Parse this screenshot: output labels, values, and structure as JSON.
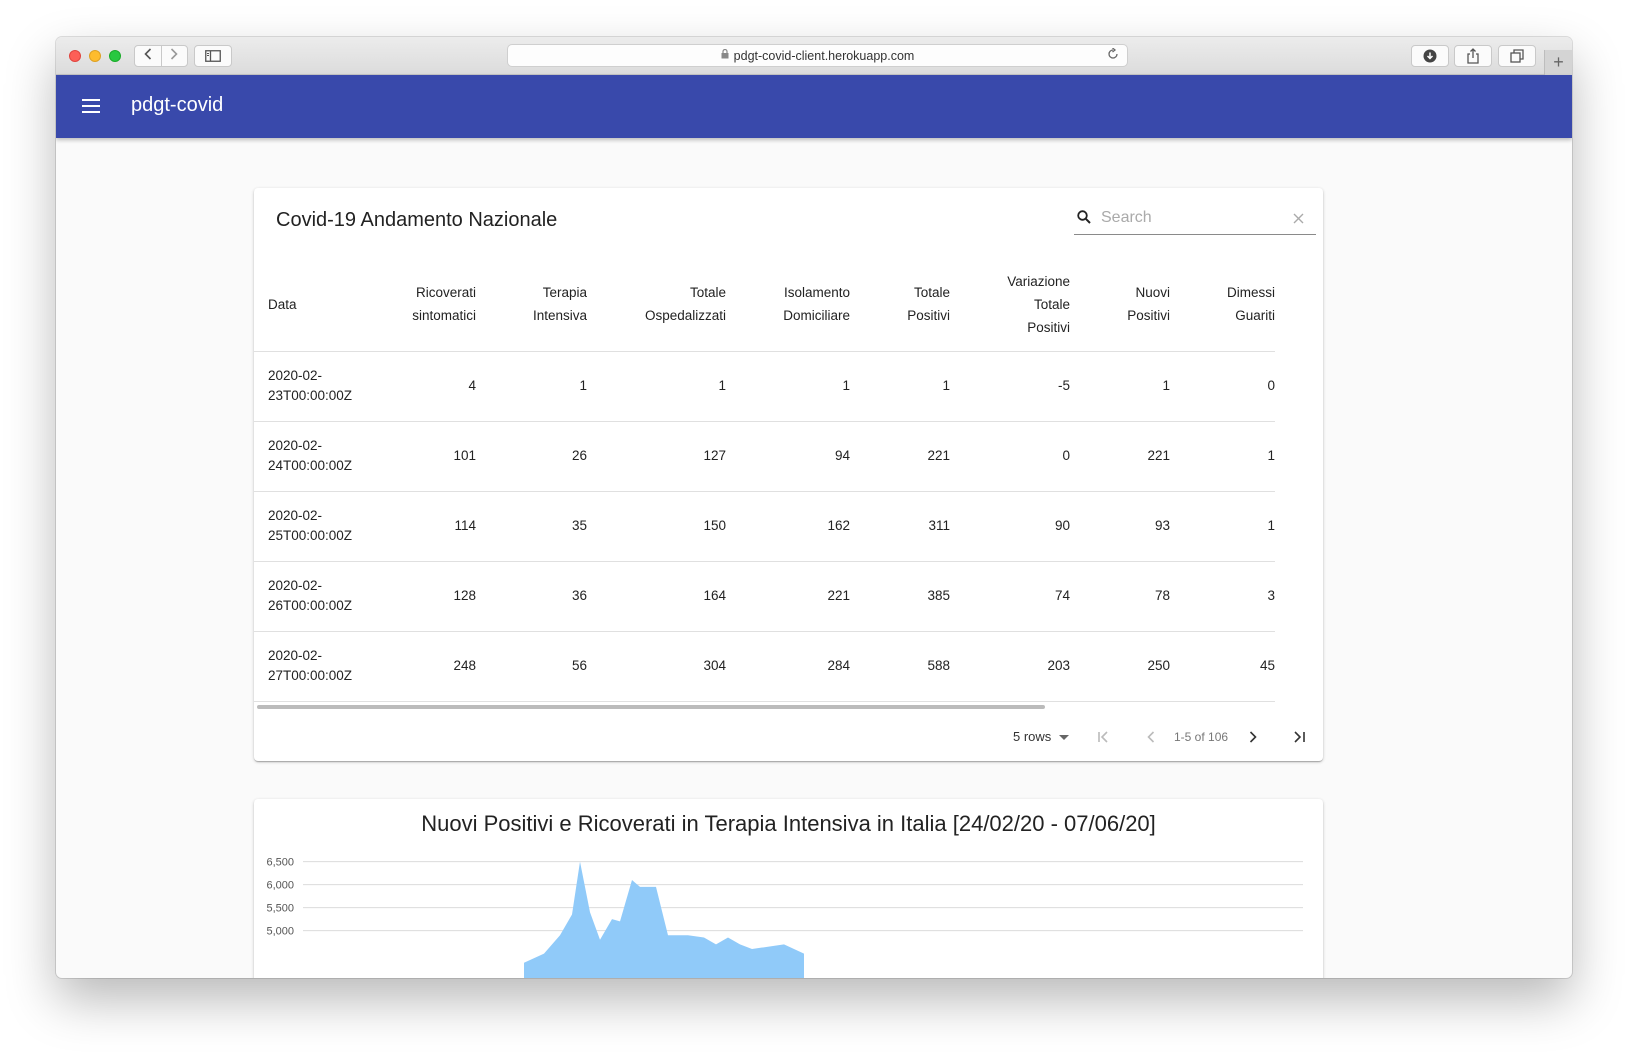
{
  "browser": {
    "url": "pdgt-covid-client.herokuapp.com",
    "back_icon": "chevron-left-icon",
    "forward_icon": "chevron-right-icon",
    "sidebar_icon": "sidebar-icon",
    "download_icon": "download-icon",
    "share_icon": "share-icon",
    "tabs_icon": "tabs-overview-icon",
    "new_tab_icon": "plus-icon"
  },
  "appbar": {
    "title": "pdgt-covid",
    "menu_icon": "menu-icon",
    "color": "#3949ab"
  },
  "table_card": {
    "title": "Covid-19 Andamento Nazionale",
    "search": {
      "placeholder": "Search",
      "value": ""
    },
    "columns": [
      [
        "Data"
      ],
      [
        "Ricoverati",
        "sintomatici"
      ],
      [
        "Terapia",
        "Intensiva"
      ],
      [
        "Totale",
        "Ospedalizzati"
      ],
      [
        "Isolamento",
        "Domiciliare"
      ],
      [
        "Totale",
        "Positivi"
      ],
      [
        "Variazione",
        "Totale",
        "Positivi"
      ],
      [
        "Nuovi",
        "Positivi"
      ],
      [
        "Dimessi",
        "Guariti"
      ]
    ],
    "rows": [
      [
        "2020-02-",
        "23T00:00:00Z",
        "4",
        "1",
        "1",
        "1",
        "1",
        "-5",
        "1",
        "0"
      ],
      [
        "2020-02-",
        "24T00:00:00Z",
        "101",
        "26",
        "127",
        "94",
        "221",
        "0",
        "221",
        "1"
      ],
      [
        "2020-02-",
        "25T00:00:00Z",
        "114",
        "35",
        "150",
        "162",
        "311",
        "90",
        "93",
        "1"
      ],
      [
        "2020-02-",
        "26T00:00:00Z",
        "128",
        "36",
        "164",
        "221",
        "385",
        "74",
        "78",
        "3"
      ],
      [
        "2020-02-",
        "27T00:00:00Z",
        "248",
        "56",
        "304",
        "284",
        "588",
        "203",
        "250",
        "45"
      ]
    ],
    "pagination": {
      "rows_per_page": "5 rows",
      "range": "1-5 of 106"
    }
  },
  "chart_card": {
    "title": "Nuovi Positivi e Ricoverati in Terapia Intensiva in Italia [24/02/20 - 07/06/20]"
  },
  "chart_data": {
    "type": "area",
    "title": "Nuovi Positivi e Ricoverati in Terapia Intensiva in Italia [24/02/20 - 07/06/20]",
    "y_ticks": [
      5000,
      5500,
      6000,
      6500
    ],
    "y_tick_labels": [
      "5,000",
      "5,500",
      "6,000",
      "6,500"
    ],
    "ylim": [
      4700,
      6600
    ],
    "grid": true,
    "series": [
      {
        "color": "#90caf9",
        "x_index": [
          0,
          10,
          18,
          24,
          28,
          33,
          38,
          44,
          48,
          54,
          58,
          66,
          72,
          82,
          90,
          96,
          102,
          108,
          114,
          130,
          140
        ],
        "values": [
          4300,
          4500,
          4900,
          5350,
          6500,
          5400,
          4800,
          5250,
          5200,
          6100,
          5950,
          5950,
          4900,
          4900,
          4850,
          4700,
          4850,
          4700,
          4600,
          4700,
          4500
        ]
      }
    ]
  }
}
